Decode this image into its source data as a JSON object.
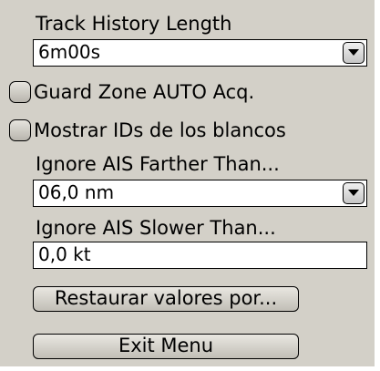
{
  "track_history": {
    "label": "Track History Length",
    "value": "6m00s"
  },
  "guard_zone": {
    "label": "Guard Zone AUTO Acq.",
    "checked": false
  },
  "target_ids": {
    "label": "Mostrar IDs de los blancos",
    "checked": false
  },
  "ais_farther": {
    "label": "Ignore AIS Farther Than...",
    "value": "06,0 nm"
  },
  "ais_slower": {
    "label": "Ignore AIS Slower Than...",
    "value": "0,0 kt"
  },
  "buttons": {
    "restore_label": "Restaurar valores por...",
    "exit_label": "Exit Menu"
  },
  "icons": {
    "dropdown": "chevron-down-icon",
    "checkbox": "checkbox-unchecked-icon"
  },
  "colors": {
    "panel_background": "#d3d0c8",
    "field_background": "#ffffff",
    "border": "#000000"
  }
}
